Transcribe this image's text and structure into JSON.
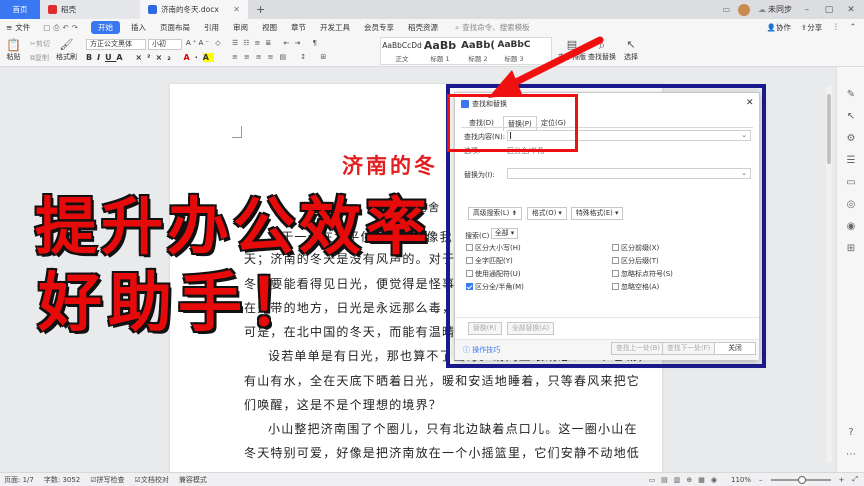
{
  "titlebar": {
    "tabs": [
      "首页",
      "稻壳",
      "济南的冬天.docx"
    ],
    "right": [
      "未同步",
      "协作",
      "分享"
    ]
  },
  "menubar": {
    "items": [
      "文件",
      "开始",
      "插入",
      "页面布局",
      "引用",
      "审阅",
      "视图",
      "章节",
      "开发工具",
      "会员专享",
      "稻壳资源"
    ],
    "search_placeholder": "查找命令、搜索模板"
  },
  "ribbon": {
    "paste": "粘贴",
    "cut": "剪切",
    "copy": "复制",
    "format_painter": "格式刷",
    "font_name": "方正公文黑体",
    "font_size": "小初",
    "styles": [
      {
        "preview": "AaBbCcDd",
        "name": "正文"
      },
      {
        "preview": "AaBb",
        "name": "标题 1"
      },
      {
        "preview": "AaBb(",
        "name": "标题 2"
      },
      {
        "preview": "AaBbC",
        "name": "标题 3"
      }
    ],
    "text_layout": "文字排版",
    "find_replace": "查找替换",
    "select": "选择"
  },
  "document": {
    "title": "济南的冬",
    "title_right": "天",
    "fragment": "老舍",
    "lines": [
      "对于一个在北平住惯的人，像我，冬",
      "天；济南的冬天是没有风声的。对于一个",
      "冬天要能看得见日光，便觉得是怪事；济",
      "在热带的地方，日光是永远那么毒，响亮",
      "可是，在北中国的冬天，而能有温晴的天",
      "设若单单是有日光，那也算不了出奇。请闭上眼睛想：一个老城，",
      "有山有水，全在天底下晒着日光，暖和安适地睡着，只等春风来把它",
      "们唤醒，这是不是个理想的境界？",
      "小山整把济南围了个圈儿，只有北边缺着点口儿。这一圈小山在",
      "冬天特别可爱，好像是把济南放在一个小摇篮里，它们安静不动地低"
    ]
  },
  "captions": {
    "line1": "提升办公效率",
    "line2": "好助手！"
  },
  "dialog": {
    "title": "查找和替换",
    "tabs": [
      "查找(D)",
      "替换(P)",
      "定位(G)"
    ],
    "find_label": "查找内容(N):",
    "find_value": "",
    "options_label": "选项:",
    "options_value": "区分全/半角",
    "replace_label": "替换为(I):",
    "replace_value": "",
    "advanced_button": "高级搜索(L)",
    "format_button": "格式(O)",
    "special_button": "特殊格式(E)",
    "search_label": "搜索(C)",
    "search_value": "全部",
    "checks_left": [
      {
        "label": "区分大小写(H)",
        "checked": false
      },
      {
        "label": "全字匹配(Y)",
        "checked": false
      },
      {
        "label": "使用通配符(U)",
        "checked": false
      },
      {
        "label": "区分全/半角(M)",
        "checked": true
      }
    ],
    "checks_right": [
      {
        "label": "区分前缀(X)",
        "checked": false
      },
      {
        "label": "区分后缀(T)",
        "checked": false
      },
      {
        "label": "忽略标点符号(S)",
        "checked": false
      },
      {
        "label": "忽略空格(A)",
        "checked": false
      }
    ],
    "replace_button": "替换(R)",
    "replace_all_button": "全部替换(A)",
    "tips_link": "操作技巧",
    "find_prev_button": "查找上一处(B)",
    "find_next_button": "查找下一处(F)",
    "close_button": "关闭"
  },
  "status": {
    "page": "页面: 1/7",
    "words": "字数: 3052",
    "spell": "拼写检查",
    "proof": "文档校对",
    "compat": "兼容模式",
    "zoom": "110%"
  },
  "colors": {
    "accent": "#3a78f2",
    "highlight_box": "#f01010",
    "frame": "#1b1b8f",
    "caption": "#e60a0a"
  }
}
